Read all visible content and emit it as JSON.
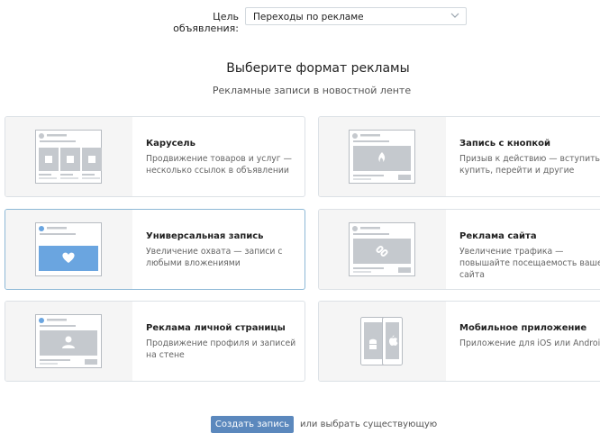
{
  "goal": {
    "label": "Цель объявления:",
    "value": "Переходы по рекламе"
  },
  "heading": "Выберите формат рекламы",
  "subheading": "Рекламные записи в новостной ленте",
  "cards": [
    {
      "title": "Карусель",
      "description": "Продвижение товаров и услуг — несколько ссылок в объявлении",
      "icon": "carousel-thumb-icon"
    },
    {
      "title": "Запись с кнопкой",
      "description": "Призыв к действию — вступить, купить, перейти и другие",
      "icon": "button-post-thumb-icon"
    },
    {
      "title": "Универсальная запись",
      "description": "Увеличение охвата — записи с любыми вложениями",
      "icon": "universal-post-thumb-icon",
      "selected": true
    },
    {
      "title": "Реклама сайта",
      "description": "Увеличение трафика — повышайте посещаемость вашего сайта",
      "icon": "site-ad-thumb-icon"
    },
    {
      "title": "Реклама личной страницы",
      "description": "Продвижение профиля и записей на стене",
      "icon": "personal-page-thumb-icon"
    },
    {
      "title": "Мобильное приложение",
      "description": "Приложение для iOS или Android",
      "icon": "mobile-app-thumb-icon"
    }
  ],
  "footer": {
    "create_label": "Создать запись",
    "or_label": "или выбрать существующую"
  },
  "colors": {
    "accent": "#5b88bd",
    "selected_border": "#8db8d6",
    "thumb_highlight": "#6aa5e0",
    "badge": "#e64646"
  }
}
